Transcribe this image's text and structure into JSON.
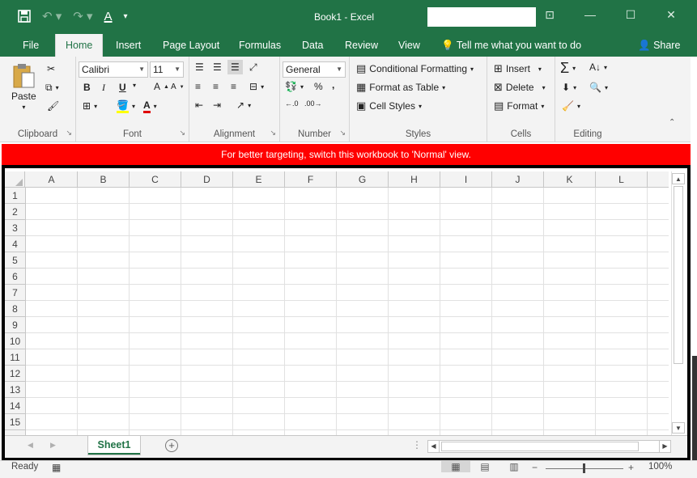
{
  "titlebar": {
    "title": "Book1  -  Excel",
    "qat": {
      "save_icon": "save-icon",
      "undo_icon": "undo-icon",
      "redo_icon": "redo-icon",
      "font_color_icon": "font-color-icon"
    },
    "window_buttons": [
      "ribbon-display-icon",
      "minimize-icon",
      "restore-icon",
      "close-icon"
    ]
  },
  "tabs": {
    "items": [
      "File",
      "Home",
      "Insert",
      "Page Layout",
      "Formulas",
      "Data",
      "Review",
      "View"
    ],
    "active": "Home",
    "tell_me": "Tell me what you want to do",
    "share": "Share"
  },
  "ribbon": {
    "clipboard": {
      "label": "Clipboard",
      "paste": "Paste"
    },
    "font": {
      "label": "Font",
      "font_name": "Calibri",
      "font_size": "11",
      "bold": "B",
      "italic": "I",
      "underline": "U"
    },
    "alignment": {
      "label": "Alignment"
    },
    "number": {
      "label": "Number",
      "format": "General",
      "percent": "%",
      "comma": ","
    },
    "styles": {
      "label": "Styles",
      "conditional": "Conditional Formatting",
      "format_table": "Format as Table",
      "cell_styles": "Cell Styles"
    },
    "cells": {
      "label": "Cells",
      "insert": "Insert",
      "delete": "Delete",
      "format": "Format"
    },
    "editing": {
      "label": "Editing"
    }
  },
  "banner": {
    "text": "For better targeting, switch this workbook to 'Normal' view."
  },
  "grid": {
    "columns": [
      "A",
      "B",
      "C",
      "D",
      "E",
      "F",
      "G",
      "H",
      "I",
      "J",
      "K",
      "L"
    ],
    "rows": [
      "1",
      "2",
      "3",
      "4",
      "5",
      "6",
      "7",
      "8",
      "9",
      "10",
      "11",
      "12",
      "13",
      "14",
      "15"
    ]
  },
  "sheets": {
    "active": "Sheet1"
  },
  "status": {
    "ready": "Ready",
    "zoom": "100%"
  },
  "colors": {
    "accent": "#217346",
    "banner": "#ff0000"
  }
}
